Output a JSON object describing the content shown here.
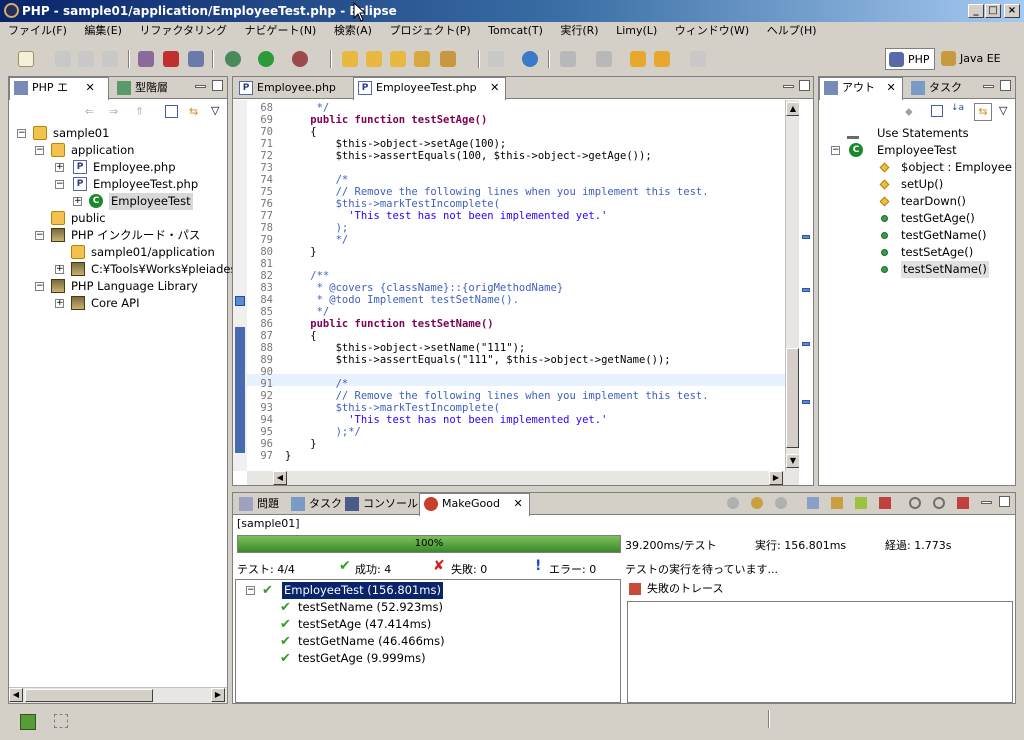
{
  "window": {
    "title": "PHP - sample01/application/EmployeeTest.php - Eclipse"
  },
  "menu": [
    "ファイル(F)",
    "編集(E)",
    "リファクタリング",
    "ナビゲート(N)",
    "検索(A)",
    "プロジェクト(P)",
    "Tomcat(T)",
    "実行(R)",
    "Limy(L)",
    "ウィンドウ(W)",
    "ヘルプ(H)"
  ],
  "perspectives": {
    "php": "PHP",
    "javaee": "Java EE"
  },
  "explorer": {
    "tabs": [
      "PHP エ",
      "型階層"
    ],
    "tree": [
      "sample01",
      "application",
      "Employee.php",
      "EmployeeTest.php",
      "EmployeeTest",
      "public",
      "PHP インクルード・パス",
      "sample01/application",
      "C:¥Tools¥Works¥pleiades¥",
      "PHP Language Library",
      "Core API"
    ]
  },
  "editor": {
    "tabs": [
      "Employee.php",
      "EmployeeTest.php"
    ],
    "lines": [
      {
        "n": "68",
        "t": "     */"
      },
      {
        "n": "69",
        "t": "    public function testSetAge()"
      },
      {
        "n": "70",
        "t": "    {"
      },
      {
        "n": "71",
        "t": "        $this->object->setAge(100);"
      },
      {
        "n": "72",
        "t": "        $this->assertEquals(100, $this->object->getAge());"
      },
      {
        "n": "73",
        "t": ""
      },
      {
        "n": "74",
        "t": "        /*"
      },
      {
        "n": "75",
        "t": "        // Remove the following lines when you implement this test."
      },
      {
        "n": "76",
        "t": "        $this->markTestIncomplete("
      },
      {
        "n": "77",
        "t": "          'This test has not been implemented yet.'"
      },
      {
        "n": "78",
        "t": "        );"
      },
      {
        "n": "79",
        "t": "        */"
      },
      {
        "n": "80",
        "t": "    }"
      },
      {
        "n": "81",
        "t": ""
      },
      {
        "n": "82",
        "t": "    /**"
      },
      {
        "n": "83",
        "t": "     * @covers {className}::{origMethodName}"
      },
      {
        "n": "84",
        "t": "     * @todo Implement testSetName()."
      },
      {
        "n": "85",
        "t": "     */"
      },
      {
        "n": "86",
        "t": "    public function testSetName()"
      },
      {
        "n": "87",
        "t": "    {"
      },
      {
        "n": "88",
        "t": "        $this->object->setName(\"111\");"
      },
      {
        "n": "89",
        "t": "        $this->assertEquals(\"111\", $this->object->getName());"
      },
      {
        "n": "90",
        "t": ""
      },
      {
        "n": "91",
        "t": "        /*"
      },
      {
        "n": "92",
        "t": "        // Remove the following lines when you implement this test."
      },
      {
        "n": "93",
        "t": "        $this->markTestIncomplete("
      },
      {
        "n": "94",
        "t": "          'This test has not been implemented yet.'"
      },
      {
        "n": "95",
        "t": "        );*/"
      },
      {
        "n": "96",
        "t": "    }"
      },
      {
        "n": "97",
        "t": "}"
      }
    ]
  },
  "outline": {
    "tabs": [
      "アウト",
      "タスク"
    ],
    "items": [
      "Use Statements",
      "EmployeeTest",
      "$object : Employee",
      "setUp()",
      "tearDown()",
      "testGetAge()",
      "testGetName()",
      "testSetAge()",
      "testSetName()"
    ]
  },
  "bottom": {
    "tabs": [
      "問題",
      "タスク",
      "コンソール",
      "MakeGood"
    ],
    "target": "[sample01]",
    "progress_label": "100%",
    "progress": 1.0,
    "per_test": "39.200ms/テスト",
    "exec": "実行: 156.801ms",
    "elapsed": "経過: 1.773s",
    "tests": "テスト: 4/4",
    "success": "成功: 4",
    "failure": "失敗: 0",
    "error": "エラー: 0",
    "waiting": "テストの実行を待っています...",
    "trace_title": "失敗のトレース",
    "results": [
      "EmployeeTest (156.801ms)",
      "testSetName (52.923ms)",
      "testSetAge (47.414ms)",
      "testGetName (46.466ms)",
      "testGetAge (9.999ms)"
    ]
  }
}
